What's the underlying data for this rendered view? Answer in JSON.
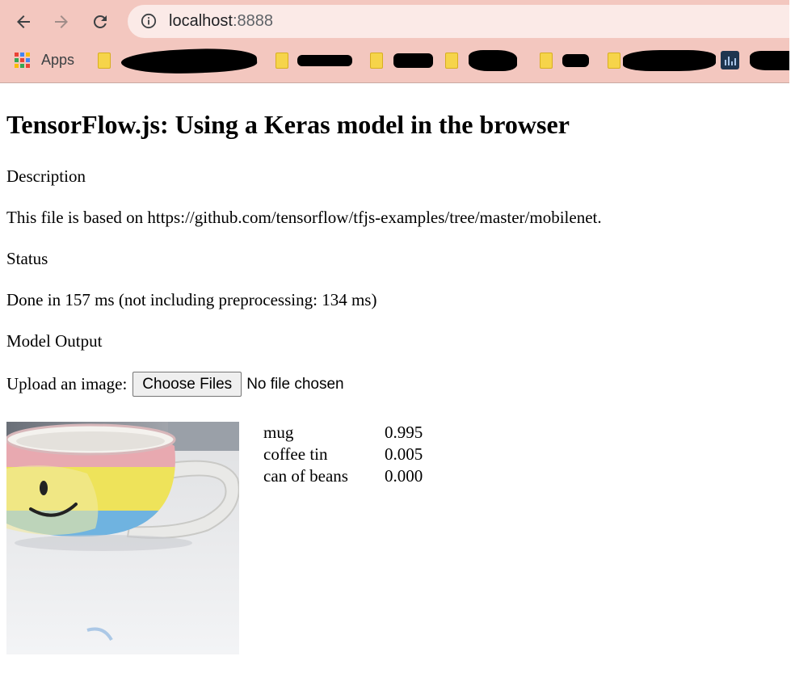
{
  "browser": {
    "url_host": "localhost",
    "url_port": ":8888",
    "bookmarks": {
      "apps_label": "Apps"
    }
  },
  "page": {
    "title": "TensorFlow.js: Using a Keras model in the browser",
    "description_heading": "Description",
    "description_text": "This file is based on https://github.com/tensorflow/tfjs-examples/tree/master/mobilenet.",
    "status_heading": "Status",
    "status_text": "Done in 157 ms (not including preprocessing: 134 ms)",
    "output_heading": "Model Output",
    "upload_label": "Upload an image:",
    "choose_files_label": "Choose Files",
    "no_file_text": "No file chosen",
    "predictions": [
      {
        "label": "mug",
        "score": "0.995"
      },
      {
        "label": "coffee tin",
        "score": "0.005"
      },
      {
        "label": "can of beans",
        "score": "0.000"
      }
    ]
  },
  "colors": {
    "chrome_bg": "#f3c7bf",
    "omnibox_bg": "#fbeae7"
  }
}
